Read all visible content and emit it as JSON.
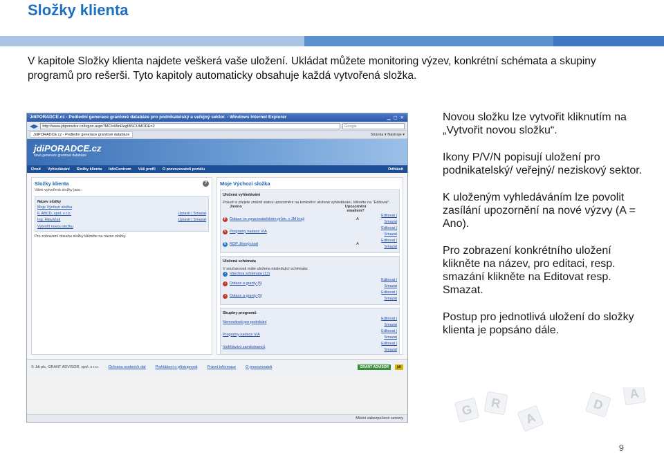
{
  "slide": {
    "title": "Složky klienta",
    "intro": "V kapitole Složky klienta najdete veškerá vaše uložení. Ukládat můžete monitoring výzev, konkrétní schémata a skupiny programů pro rešerši. Tyto kapitoly automaticky obsahuje každá vytvořená složka.",
    "page_number": "9"
  },
  "side_text": [
    "Novou složku lze vytvořit kliknutím na „Vytvořit novou složku“.",
    "Ikony P/V/N popisují uložení pro podnikatelský/ veřejný/ neziskový sektor.",
    "K uloženým vyhledáváním lze povolit zasílání upozornění na nové výzvy (A = Ano).",
    "Pro zobrazení konkrétního uložení klikněte na název, pro editaci, resp. smazání klikněte na Editovat resp. Smazat.",
    "Postup pro jednotlivá uložení do složky klienta je popsáno dále."
  ],
  "browser": {
    "title": "JdiPORADCE.cz - Podlední generace grantové databáze pro podnikatelský a veřejný sektor. - Windows Internet Explorer",
    "url": "http://www.jdiporadce.cz/logon.aspx?MCI=MinRegIBSCUMODE=2",
    "search_placeholder": "Google",
    "tab": "JdiPORADCE.cz - Podlední generace grantové databáze",
    "tools": "Stránka ▾  Nástroje ▾",
    "status": "Místní zabezpečené servery"
  },
  "site": {
    "logo": "jdiPORADCE.cz",
    "logo_tagline": "nová generace grantové databáze",
    "nav": [
      "Úvod",
      "Vyhledávání",
      "Složky klienta",
      "InfoCentrum",
      "Váš profil",
      "O provozovateli portálu"
    ],
    "logout": "Odhlásit",
    "left": {
      "title": "Složky klienta",
      "subtitle": "Vámi vytvořené složky jsou:",
      "folders_header": "Název složky",
      "folders": [
        {
          "name": "Moje Výchozí složka",
          "actions": ""
        },
        {
          "name": "F. ABCD, spol. s r.o.",
          "actions": "Upravit | Smazat"
        },
        {
          "name": "Ing. Hlaváček",
          "actions": "Upravit | Smazat"
        }
      ],
      "folders_top": "Název složky",
      "new_folder": "Vytvořit novou složku",
      "note": "Pro zobrazení obsahu složky klikněte na název složky."
    },
    "right": {
      "title": "Moje Výchozí složka",
      "subtitle": "Uložená vyhledávání",
      "description": "Pokud si přejete změnit status upozornění na konkrétní uložené vyhledávání, klikněte na \"Editovat\".",
      "col_name": "Jméno",
      "col_alert": "Upozornění emailem?",
      "searches": [
        {
          "icon": "P",
          "type": "p",
          "name": "Dotace ve zpracovatelském prům. v JM kraji",
          "alert": "A",
          "actions": "Editovat | Smazat"
        },
        {
          "icon": "V",
          "type": "v",
          "name": "Programy nadace VIA",
          "alert": "",
          "actions": "Editovat | Smazat"
        },
        {
          "icon": "N",
          "type": "n",
          "name": "ROP Jihovýchod",
          "alert": "A",
          "actions": "Editovat | Smazat"
        }
      ],
      "schemes_title": "Uložená schémata",
      "schemes_note": "V současnosti máte uložena následující schémata:",
      "schemes": [
        {
          "name": "Všechna schémata (12)",
          "actions": ""
        },
        {
          "name": "Dotace a granty (5)",
          "actions": "Editovat | Smazat"
        },
        {
          "name": "Dotace a granty (5)",
          "actions": "Editovat | Smazat"
        }
      ],
      "groups_title": "Skupiny programů",
      "groups": [
        {
          "name": "Nemovitosti pro podnikání",
          "actions": "Editovat | Smazat"
        },
        {
          "name": "Programy nadace VIA",
          "actions": "Editovat | Smazat"
        },
        {
          "name": "Vzdělávání zaměstnanců",
          "actions": "Editovat | Smazat"
        }
      ]
    },
    "footer": {
      "copyright": "© Jdi plc, GRANT ADVISOR, spol. s r.o.",
      "links": [
        "Ochrana osobních dat",
        "Prohlášení o přístupnosti",
        "Právní informace",
        "O provozovateli"
      ],
      "logos": [
        "GRANT ADVISOR",
        "jdi"
      ]
    }
  },
  "decor_tiles": [
    "G",
    "R",
    "A",
    "D",
    "A"
  ]
}
